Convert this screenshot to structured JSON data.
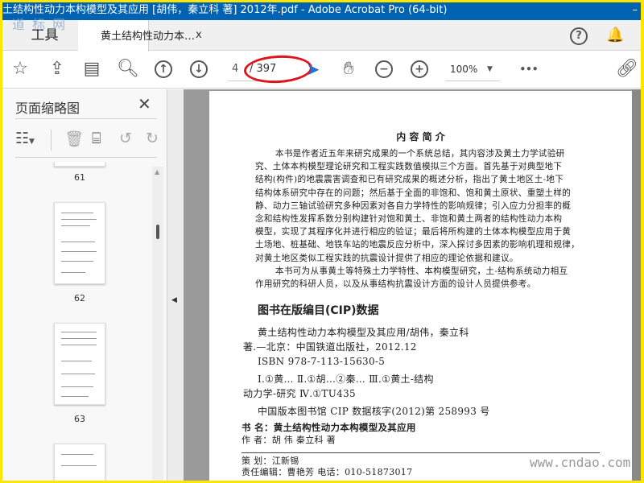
{
  "window": {
    "title": "土结构性动力本构模型及其应用 [胡伟，秦立科 著] 2012年.pdf - Adobe Acrobat Pro (64-bit)",
    "watermark": "道 标 网",
    "minimize": "–"
  },
  "tabs": {
    "tools": "工具",
    "document": "黄土结构性动力本…",
    "close": "x"
  },
  "header_icons": {
    "help": "?",
    "bell": "🔔"
  },
  "toolbar": {
    "page_current": "4",
    "page_total": "/ 397",
    "zoom": "100%",
    "zoom_caret": "▼",
    "more": "•••",
    "icons": [
      "star-icon",
      "cloud-upload-icon",
      "print-icon",
      "search-zoom-icon",
      "prev-page-icon",
      "next-page-icon",
      "select-cursor-icon",
      "hand-icon",
      "zoom-out-icon",
      "zoom-in-icon",
      "more-icon",
      "link-icon"
    ]
  },
  "panel": {
    "title": "页面缩略图",
    "close": "✕",
    "thumbs": [
      {
        "label": "61"
      },
      {
        "label": "62"
      },
      {
        "label": "63"
      }
    ]
  },
  "page": {
    "intro_title": "内 容 简 介",
    "intro_lines": [
      "本书是作者近五年来研究成果的一个系统总结，其内容涉及黄土力学试验研",
      "究、土体本构模型理论研究和工程实践数值模拟三个方面。首先基于对典型地下",
      "结构(构件)的地震震害调查和已有研究成果的概述分析，指出了黄土地区土-地下",
      "结构体系研究中存在的问题；然后基于全面的非饱和、饱和黄土原状、重塑土样的",
      "静、动力三轴试验研究多种因素对各自力学特性的影响规律；引入应力分担率的概",
      "念和结构性发挥系数分别构建针对饱和黄土、非饱和黄土两者的结构性动力本构",
      "模型，实现了其程序化并进行相应的验证；最后将所构建的土体本构模型应用于黄",
      "土场地、桩基础、地铁车站的地震反应分析中，深入探讨多因素的影响机理和规律，",
      "对黄土地区类似工程实践的抗震设计提供了相应的理论依据和建议。",
      "本书可为从事黄土等特殊土力学特性、本构模型研究，土-结构系统动力相互",
      "作用研究的科研人员，以及从事结构抗震设计方面的设计人员提供参考。"
    ],
    "cip_title": "图书在版编目(CIP)数据",
    "cip_lines": [
      "黄土结构性动力本构模型及其应用/胡伟，秦立科",
      "著.—北京：中国铁道出版社，2012.12",
      "ISBN 978-7-113-15630-5",
      "Ⅰ.①黄…  Ⅱ.①胡…②秦…  Ⅲ.①黄土-结构",
      "动力学-研究  Ⅳ.①TU435",
      "中国版本图书馆 CIP 数据核字(2012)第 258993 号"
    ],
    "book_name": "书    名：黄土结构性动力本构模型及其应用",
    "authors": "作    者：胡  伟  秦立科  著",
    "planner": "策    划：江新锡",
    "editor": "责任编辑：曹艳芳          电话：010-51873017"
  },
  "site_watermark": "www.cndao.com"
}
